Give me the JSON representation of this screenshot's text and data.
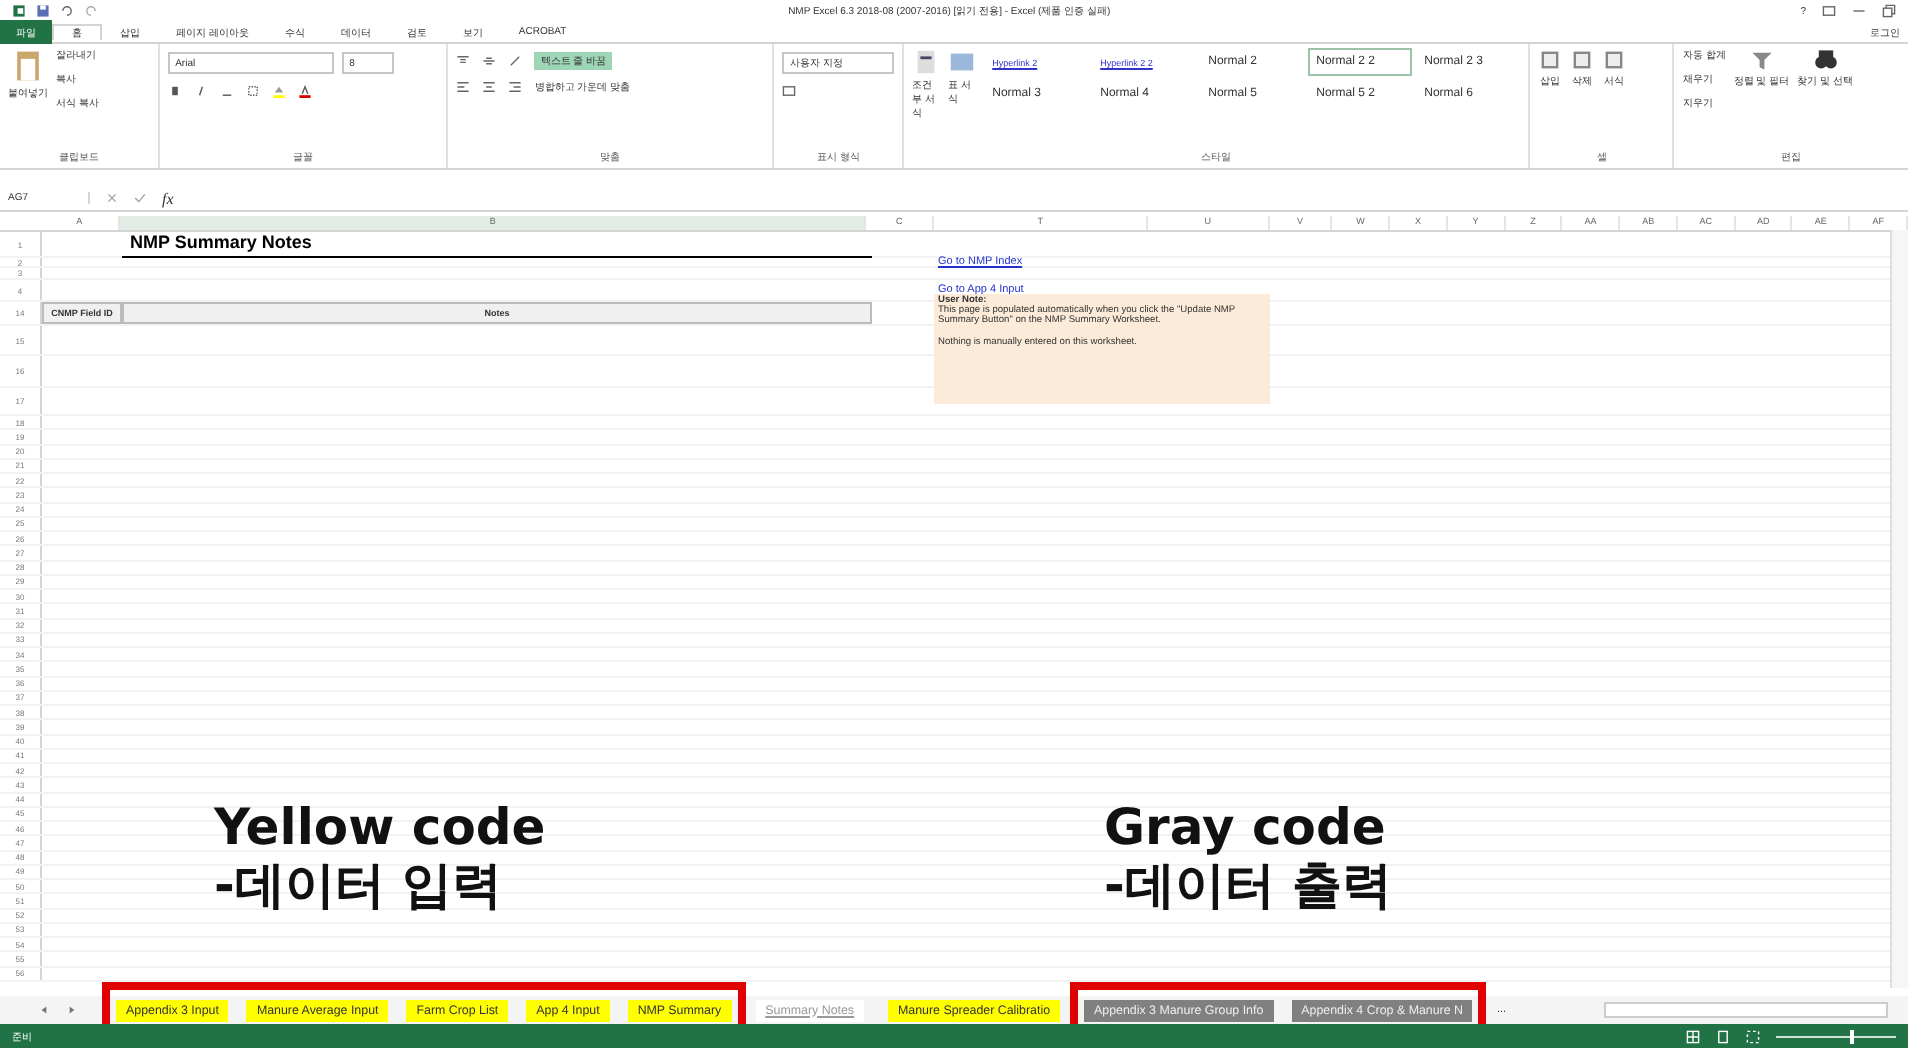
{
  "window": {
    "title": "NMP Excel 6.3 2018-08 (2007-2016) [읽기 전용] - Excel (제품 인증 실패)",
    "help": "?",
    "account": "로그인"
  },
  "file_tab": "파일",
  "ribbon_tabs": [
    {
      "label": "홈",
      "selected": true
    },
    {
      "label": "삽입",
      "selected": false
    },
    {
      "label": "페이지 레이아웃",
      "selected": false
    },
    {
      "label": "수식",
      "selected": false
    },
    {
      "label": "데이터",
      "selected": false
    },
    {
      "label": "검토",
      "selected": false
    },
    {
      "label": "보기",
      "selected": false
    },
    {
      "label": "ACROBAT",
      "selected": false
    }
  ],
  "ribbon": {
    "clipboard": {
      "paste": "붙여넣기",
      "cut": "잘라내기",
      "copy": "복사",
      "format_painter": "서식 복사",
      "label": "클립보드"
    },
    "font": {
      "name": "Arial",
      "size": "8",
      "label": "글꼴"
    },
    "alignment": {
      "wrap": "텍스트 줄 바꿈",
      "wrap_on": true,
      "merge": "병합하고 가운데 맞춤",
      "label": "맞춤"
    },
    "number": {
      "format": "사용자 지정",
      "label": "표시 형식"
    },
    "styles": {
      "conditional": "조건부 서식",
      "table": "표 서식",
      "label": "스타일",
      "items": [
        {
          "label": "Hyperlink 2",
          "kind": "link",
          "selected": false
        },
        {
          "label": "Hyperlink 2 2",
          "kind": "link",
          "selected": false
        },
        {
          "label": "Normal 2",
          "kind": "normal",
          "selected": false
        },
        {
          "label": "Normal 2 2",
          "kind": "normal",
          "selected": true
        },
        {
          "label": "Normal 2 3",
          "kind": "normal",
          "selected": false
        },
        {
          "label": "Normal 3",
          "kind": "normal",
          "selected": false
        },
        {
          "label": "Normal 4",
          "kind": "normal",
          "selected": false
        },
        {
          "label": "Normal 5",
          "kind": "normal",
          "selected": false
        },
        {
          "label": "Normal 5 2",
          "kind": "normal",
          "selected": false
        },
        {
          "label": "Normal 6",
          "kind": "normal",
          "selected": false
        }
      ]
    },
    "cells": {
      "items": [
        "삽입",
        "삭제",
        "서식"
      ],
      "label": "셀"
    },
    "editing": {
      "items": [
        "자동 합계",
        "채우기",
        "지우기"
      ],
      "sort": "정렬 및 필터",
      "find": "찾기 및 선택",
      "label": "편집"
    }
  },
  "formula_bar": {
    "name_box": "AG7",
    "fx": "fx"
  },
  "columns": [
    "A",
    "B",
    "C",
    "T",
    "U",
    "V",
    "W",
    "X",
    "Y",
    "Z",
    "AA",
    "AB",
    "AC",
    "AD",
    "AE",
    "AF"
  ],
  "rows": [
    "1",
    "2",
    "3",
    "4",
    "14",
    "15",
    "16",
    "17",
    "18",
    "19",
    "20",
    "21",
    "22",
    "23",
    "24",
    "25",
    "26",
    "27",
    "28",
    "29",
    "30",
    "31",
    "32",
    "33",
    "34",
    "35",
    "36",
    "37",
    "38",
    "39",
    "40",
    "41",
    "42",
    "43",
    "44",
    "45",
    "46",
    "47",
    "48",
    "49",
    "50",
    "51",
    "52",
    "53",
    "54",
    "55",
    "56"
  ],
  "sheet": {
    "title": "NMP Summary Notes",
    "header": [
      "CNMP Field ID",
      "Notes"
    ],
    "links": [
      "Go to NMP Index",
      "Go to App 4 Input"
    ],
    "note": {
      "heading": "User Note:",
      "body": "This page is populated automatically when you click the \"Update NMP Summary Button\" on the NMP Summary Worksheet.",
      "footer": "Nothing is manually entered on this worksheet."
    }
  },
  "sheet_tabs": [
    {
      "label": "Appendix 3 Input",
      "color": "#ffff00",
      "selected": false
    },
    {
      "label": "Manure Average Input",
      "color": "#ffff00",
      "selected": false
    },
    {
      "label": "Farm Crop List",
      "color": "#ffff00",
      "selected": false
    },
    {
      "label": "App 4 Input",
      "color": "#ffff00",
      "selected": false
    },
    {
      "label": "NMP Summary",
      "color": "#ffff00",
      "selected": false
    },
    {
      "label": "Summary Notes",
      "color": "#ffffff",
      "selected": true
    },
    {
      "label": "Manure Spreader Calibratio",
      "color": "#ffff00",
      "selected": false
    },
    {
      "label": "Appendix 3 Manure Group Info",
      "color": "#808080",
      "selected": false
    },
    {
      "label": "Appendix 4 Crop & Manure N",
      "color": "#808080",
      "selected": false
    }
  ],
  "tab_overflow": "...",
  "annotations": [
    {
      "title": "Yellow code",
      "subtitle": "-데이터 입력"
    },
    {
      "title": "Gray code",
      "subtitle": "-데이터 출력"
    }
  ],
  "status_bar": {
    "mode": "준비",
    "zoom": {
      "level": 0.62
    }
  }
}
